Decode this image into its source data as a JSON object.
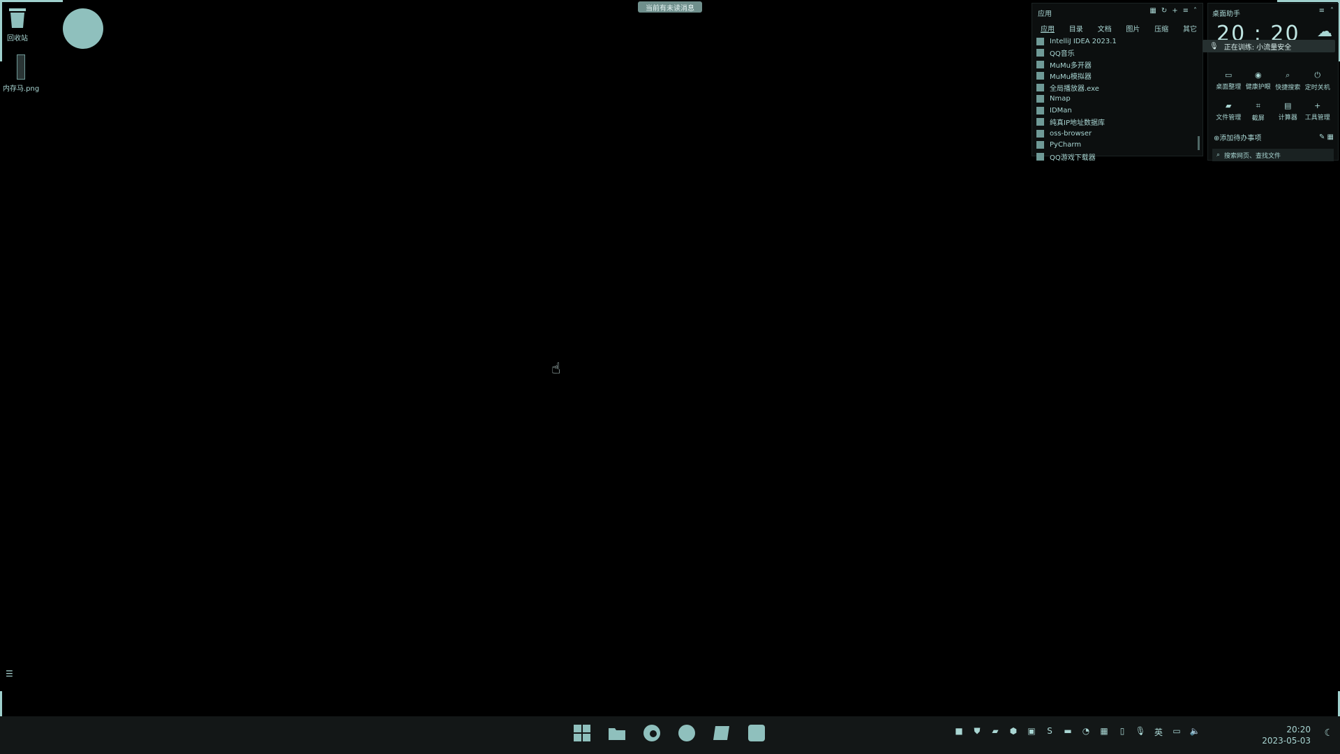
{
  "top_badge": "当前有未读消息",
  "desktop": {
    "recycle_bin_label": "回收站",
    "file_label": "内存马.png"
  },
  "app_panel": {
    "title": "应用",
    "tabs": [
      "应用",
      "目录",
      "文档",
      "图片",
      "压缩",
      "其它"
    ],
    "items": [
      "IntelliJ IDEA 2023.1",
      "QQ音乐",
      "MuMu多开器",
      "MuMu模拟器",
      "全局播放器.exe",
      "Nmap",
      "IDMan",
      "纯真IP地址数据库",
      "oss-browser",
      "PyCharm",
      "QQ游戏下载器"
    ]
  },
  "assistant": {
    "title": "桌面助手",
    "time": "20 : 20",
    "notice": "正在训练: 小流量安全",
    "tools": [
      "桌面整理",
      "健康护眼",
      "快捷搜索",
      "定时关机",
      "文件管理",
      "截屏",
      "计算器",
      "工具管理"
    ],
    "todo": "添加待办事项",
    "search_placeholder": "搜索网页、查找文件"
  },
  "taskbar": {
    "lang": "英",
    "time": "20:20",
    "date": "2023-05-03"
  },
  "colors": {
    "background": "#000000",
    "accent": "#a9d6d3"
  }
}
